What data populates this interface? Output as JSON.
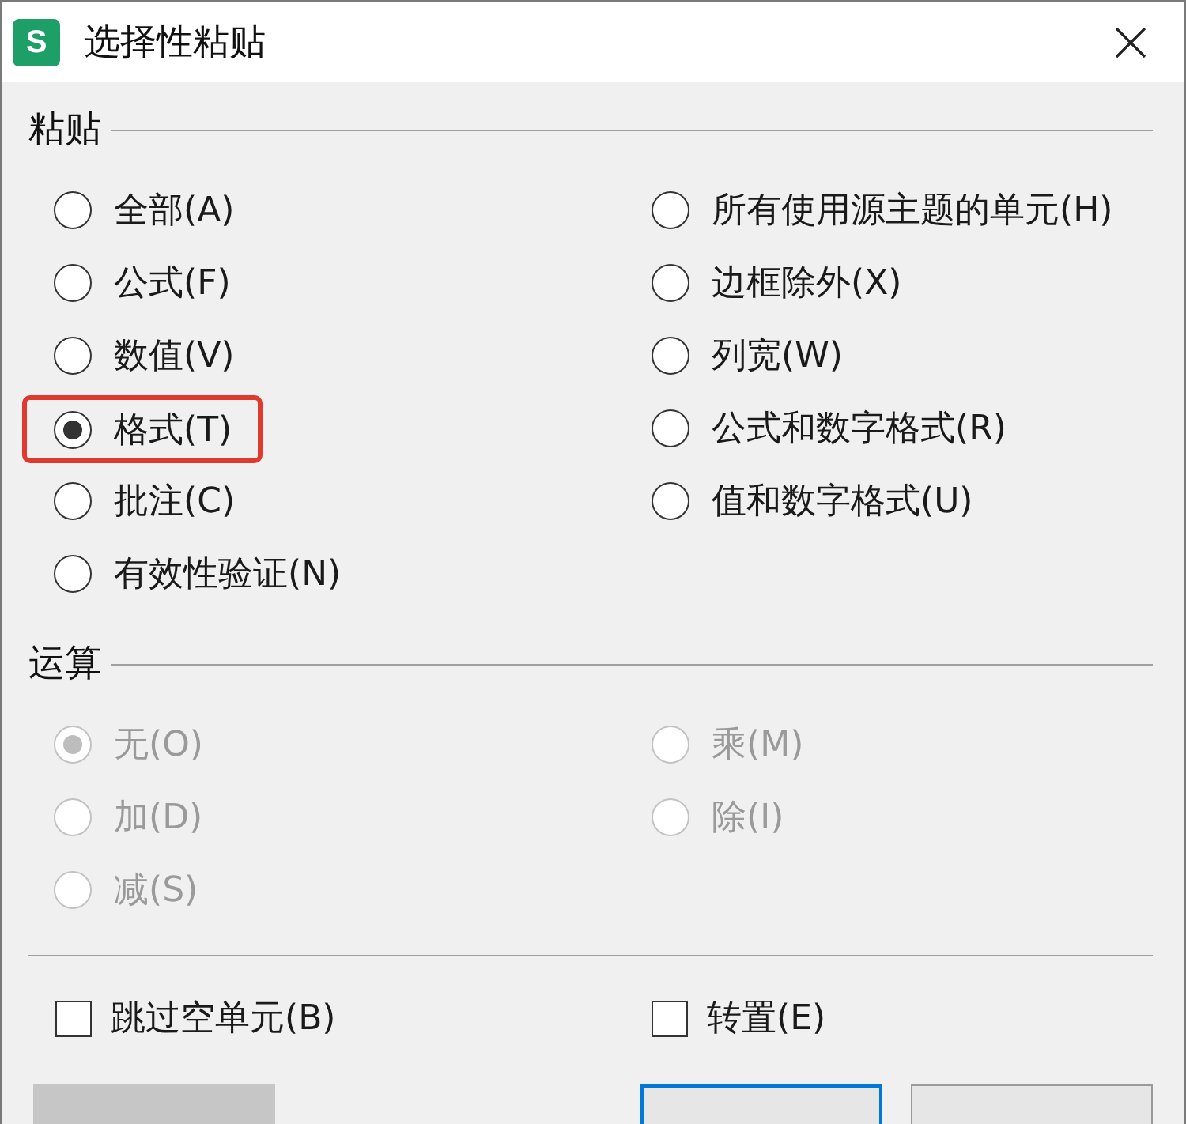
{
  "window": {
    "app_icon_letter": "S",
    "title": "选择性粘贴"
  },
  "paste": {
    "title": "粘贴",
    "disabled": false,
    "options": [
      {
        "label": "全部(A)",
        "selected": false,
        "highlighted": false
      },
      {
        "label": "公式(F)",
        "selected": false,
        "highlighted": false
      },
      {
        "label": "数值(V)",
        "selected": false,
        "highlighted": false
      },
      {
        "label": "格式(T)",
        "selected": true,
        "highlighted": true
      },
      {
        "label": "批注(C)",
        "selected": false,
        "highlighted": false
      },
      {
        "label": "有效性验证(N)",
        "selected": false,
        "highlighted": false
      },
      {
        "label": "所有使用源主题的单元(H)",
        "selected": false,
        "highlighted": false
      },
      {
        "label": "边框除外(X)",
        "selected": false,
        "highlighted": false
      },
      {
        "label": "列宽(W)",
        "selected": false,
        "highlighted": false
      },
      {
        "label": "公式和数字格式(R)",
        "selected": false,
        "highlighted": false
      },
      {
        "label": "值和数字格式(U)",
        "selected": false,
        "highlighted": false
      }
    ]
  },
  "operation": {
    "title": "运算",
    "disabled": true,
    "options": [
      {
        "label": "无(O)",
        "selected": true,
        "highlighted": false
      },
      {
        "label": "加(D)",
        "selected": false,
        "highlighted": false
      },
      {
        "label": "减(S)",
        "selected": false,
        "highlighted": false
      },
      {
        "label": "乘(M)",
        "selected": false,
        "highlighted": false
      },
      {
        "label": "除(I)",
        "selected": false,
        "highlighted": false
      }
    ]
  },
  "toggles": [
    {
      "label": "跳过空单元(B)",
      "checked": false
    },
    {
      "label": "转置(E)",
      "checked": false
    }
  ],
  "buttons": [
    {
      "disabled": true,
      "default": false
    },
    {
      "disabled": false,
      "default": true
    },
    {
      "disabled": false,
      "default": false
    }
  ]
}
